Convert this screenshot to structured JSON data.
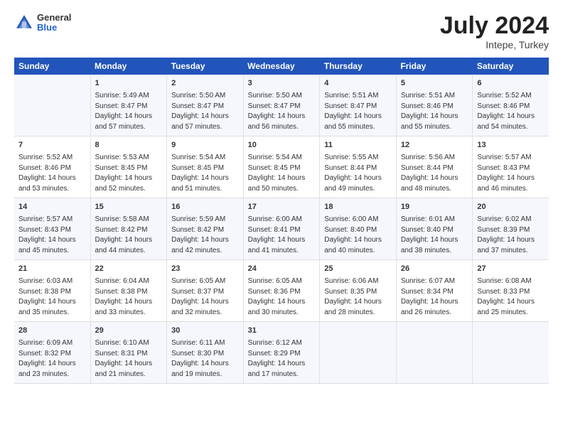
{
  "header": {
    "logo": {
      "general": "General",
      "blue": "Blue"
    },
    "title": "July 2024",
    "location": "Intepe, Turkey"
  },
  "days_of_week": [
    "Sunday",
    "Monday",
    "Tuesday",
    "Wednesday",
    "Thursday",
    "Friday",
    "Saturday"
  ],
  "weeks": [
    [
      {
        "day": "",
        "data": []
      },
      {
        "day": "1",
        "data": [
          "Sunrise: 5:49 AM",
          "Sunset: 8:47 PM",
          "Daylight: 14 hours",
          "and 57 minutes."
        ]
      },
      {
        "day": "2",
        "data": [
          "Sunrise: 5:50 AM",
          "Sunset: 8:47 PM",
          "Daylight: 14 hours",
          "and 57 minutes."
        ]
      },
      {
        "day": "3",
        "data": [
          "Sunrise: 5:50 AM",
          "Sunset: 8:47 PM",
          "Daylight: 14 hours",
          "and 56 minutes."
        ]
      },
      {
        "day": "4",
        "data": [
          "Sunrise: 5:51 AM",
          "Sunset: 8:47 PM",
          "Daylight: 14 hours",
          "and 55 minutes."
        ]
      },
      {
        "day": "5",
        "data": [
          "Sunrise: 5:51 AM",
          "Sunset: 8:46 PM",
          "Daylight: 14 hours",
          "and 55 minutes."
        ]
      },
      {
        "day": "6",
        "data": [
          "Sunrise: 5:52 AM",
          "Sunset: 8:46 PM",
          "Daylight: 14 hours",
          "and 54 minutes."
        ]
      }
    ],
    [
      {
        "day": "7",
        "data": [
          "Sunrise: 5:52 AM",
          "Sunset: 8:46 PM",
          "Daylight: 14 hours",
          "and 53 minutes."
        ]
      },
      {
        "day": "8",
        "data": [
          "Sunrise: 5:53 AM",
          "Sunset: 8:45 PM",
          "Daylight: 14 hours",
          "and 52 minutes."
        ]
      },
      {
        "day": "9",
        "data": [
          "Sunrise: 5:54 AM",
          "Sunset: 8:45 PM",
          "Daylight: 14 hours",
          "and 51 minutes."
        ]
      },
      {
        "day": "10",
        "data": [
          "Sunrise: 5:54 AM",
          "Sunset: 8:45 PM",
          "Daylight: 14 hours",
          "and 50 minutes."
        ]
      },
      {
        "day": "11",
        "data": [
          "Sunrise: 5:55 AM",
          "Sunset: 8:44 PM",
          "Daylight: 14 hours",
          "and 49 minutes."
        ]
      },
      {
        "day": "12",
        "data": [
          "Sunrise: 5:56 AM",
          "Sunset: 8:44 PM",
          "Daylight: 14 hours",
          "and 48 minutes."
        ]
      },
      {
        "day": "13",
        "data": [
          "Sunrise: 5:57 AM",
          "Sunset: 8:43 PM",
          "Daylight: 14 hours",
          "and 46 minutes."
        ]
      }
    ],
    [
      {
        "day": "14",
        "data": [
          "Sunrise: 5:57 AM",
          "Sunset: 8:43 PM",
          "Daylight: 14 hours",
          "and 45 minutes."
        ]
      },
      {
        "day": "15",
        "data": [
          "Sunrise: 5:58 AM",
          "Sunset: 8:42 PM",
          "Daylight: 14 hours",
          "and 44 minutes."
        ]
      },
      {
        "day": "16",
        "data": [
          "Sunrise: 5:59 AM",
          "Sunset: 8:42 PM",
          "Daylight: 14 hours",
          "and 42 minutes."
        ]
      },
      {
        "day": "17",
        "data": [
          "Sunrise: 6:00 AM",
          "Sunset: 8:41 PM",
          "Daylight: 14 hours",
          "and 41 minutes."
        ]
      },
      {
        "day": "18",
        "data": [
          "Sunrise: 6:00 AM",
          "Sunset: 8:40 PM",
          "Daylight: 14 hours",
          "and 40 minutes."
        ]
      },
      {
        "day": "19",
        "data": [
          "Sunrise: 6:01 AM",
          "Sunset: 8:40 PM",
          "Daylight: 14 hours",
          "and 38 minutes."
        ]
      },
      {
        "day": "20",
        "data": [
          "Sunrise: 6:02 AM",
          "Sunset: 8:39 PM",
          "Daylight: 14 hours",
          "and 37 minutes."
        ]
      }
    ],
    [
      {
        "day": "21",
        "data": [
          "Sunrise: 6:03 AM",
          "Sunset: 8:38 PM",
          "Daylight: 14 hours",
          "and 35 minutes."
        ]
      },
      {
        "day": "22",
        "data": [
          "Sunrise: 6:04 AM",
          "Sunset: 8:38 PM",
          "Daylight: 14 hours",
          "and 33 minutes."
        ]
      },
      {
        "day": "23",
        "data": [
          "Sunrise: 6:05 AM",
          "Sunset: 8:37 PM",
          "Daylight: 14 hours",
          "and 32 minutes."
        ]
      },
      {
        "day": "24",
        "data": [
          "Sunrise: 6:05 AM",
          "Sunset: 8:36 PM",
          "Daylight: 14 hours",
          "and 30 minutes."
        ]
      },
      {
        "day": "25",
        "data": [
          "Sunrise: 6:06 AM",
          "Sunset: 8:35 PM",
          "Daylight: 14 hours",
          "and 28 minutes."
        ]
      },
      {
        "day": "26",
        "data": [
          "Sunrise: 6:07 AM",
          "Sunset: 8:34 PM",
          "Daylight: 14 hours",
          "and 26 minutes."
        ]
      },
      {
        "day": "27",
        "data": [
          "Sunrise: 6:08 AM",
          "Sunset: 8:33 PM",
          "Daylight: 14 hours",
          "and 25 minutes."
        ]
      }
    ],
    [
      {
        "day": "28",
        "data": [
          "Sunrise: 6:09 AM",
          "Sunset: 8:32 PM",
          "Daylight: 14 hours",
          "and 23 minutes."
        ]
      },
      {
        "day": "29",
        "data": [
          "Sunrise: 6:10 AM",
          "Sunset: 8:31 PM",
          "Daylight: 14 hours",
          "and 21 minutes."
        ]
      },
      {
        "day": "30",
        "data": [
          "Sunrise: 6:11 AM",
          "Sunset: 8:30 PM",
          "Daylight: 14 hours",
          "and 19 minutes."
        ]
      },
      {
        "day": "31",
        "data": [
          "Sunrise: 6:12 AM",
          "Sunset: 8:29 PM",
          "Daylight: 14 hours",
          "and 17 minutes."
        ]
      },
      {
        "day": "",
        "data": []
      },
      {
        "day": "",
        "data": []
      },
      {
        "day": "",
        "data": []
      }
    ]
  ]
}
